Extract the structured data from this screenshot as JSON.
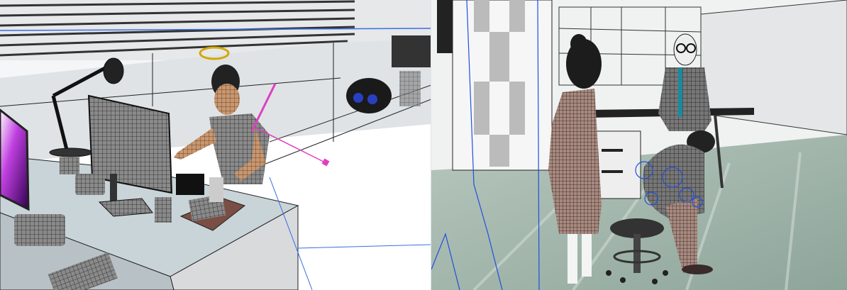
{
  "viewports": [
    {
      "id": "left",
      "scene": "office-desk-wireframe"
    },
    {
      "id": "right",
      "scene": "office-group-wireframe"
    }
  ],
  "colors": {
    "accent_blue": "#1f4fe0",
    "gizmo_magenta": "#e040c0",
    "gizmo_yellow": "#d4a800",
    "floor_green": "#9fb3a8",
    "wall_white": "#f2f4f4",
    "wire_dark": "#2a2a2a"
  }
}
